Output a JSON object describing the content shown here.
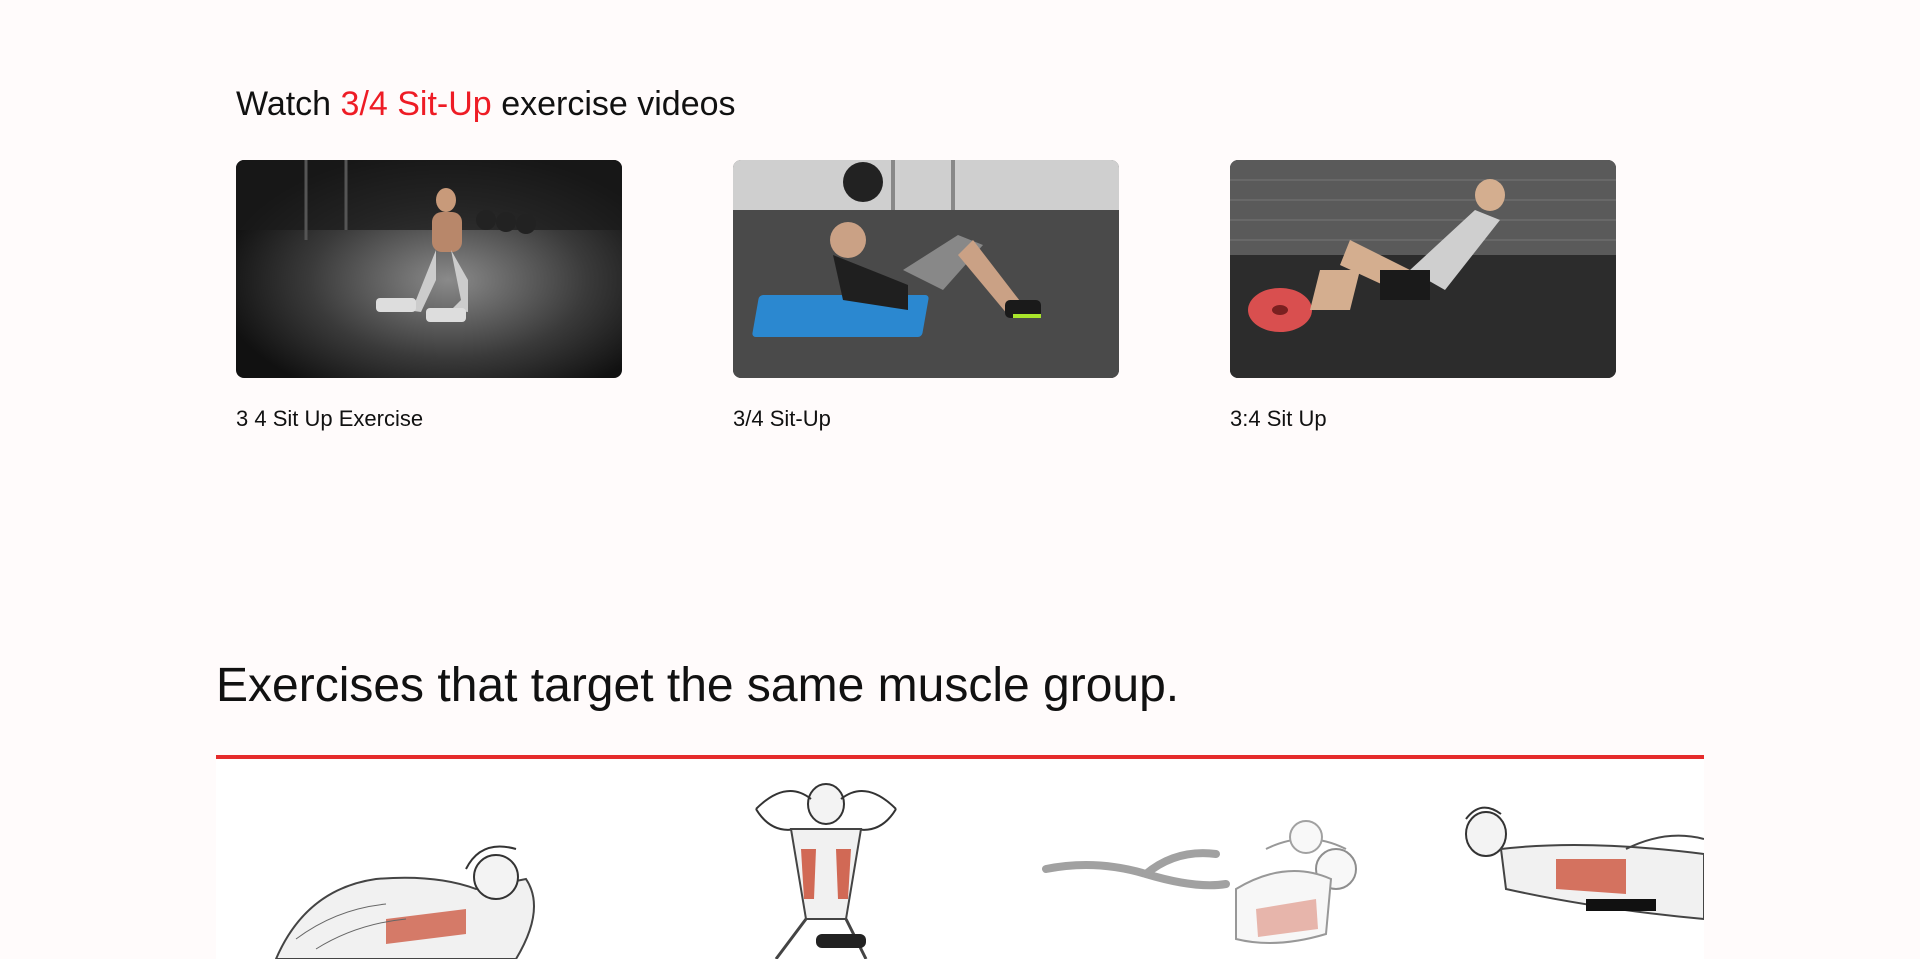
{
  "videos": {
    "heading_prefix": "Watch",
    "heading_exercise": "3/4 Sit-Up",
    "heading_suffix": "exercise videos",
    "items": [
      {
        "title": "3 4 Sit Up Exercise",
        "thumbnail": "video-thumbnail-1"
      },
      {
        "title": "3/4 Sit-Up",
        "thumbnail": "video-thumbnail-2"
      },
      {
        "title": "3:4 Sit Up",
        "thumbnail": "video-thumbnail-3"
      }
    ]
  },
  "related": {
    "heading": "Exercises that target the same muscle group.",
    "items": [
      {
        "illustration": "crunch-illustration"
      },
      {
        "illustration": "decline-sit-up-illustration"
      },
      {
        "illustration": "bicycle-crunch-illustration"
      },
      {
        "illustration": "lying-crunch-illustration"
      }
    ]
  },
  "colors": {
    "accent": "#ee1c25",
    "divider": "#e52b2b",
    "background": "#fffbfb",
    "muscle_highlight": "#c9472e"
  }
}
